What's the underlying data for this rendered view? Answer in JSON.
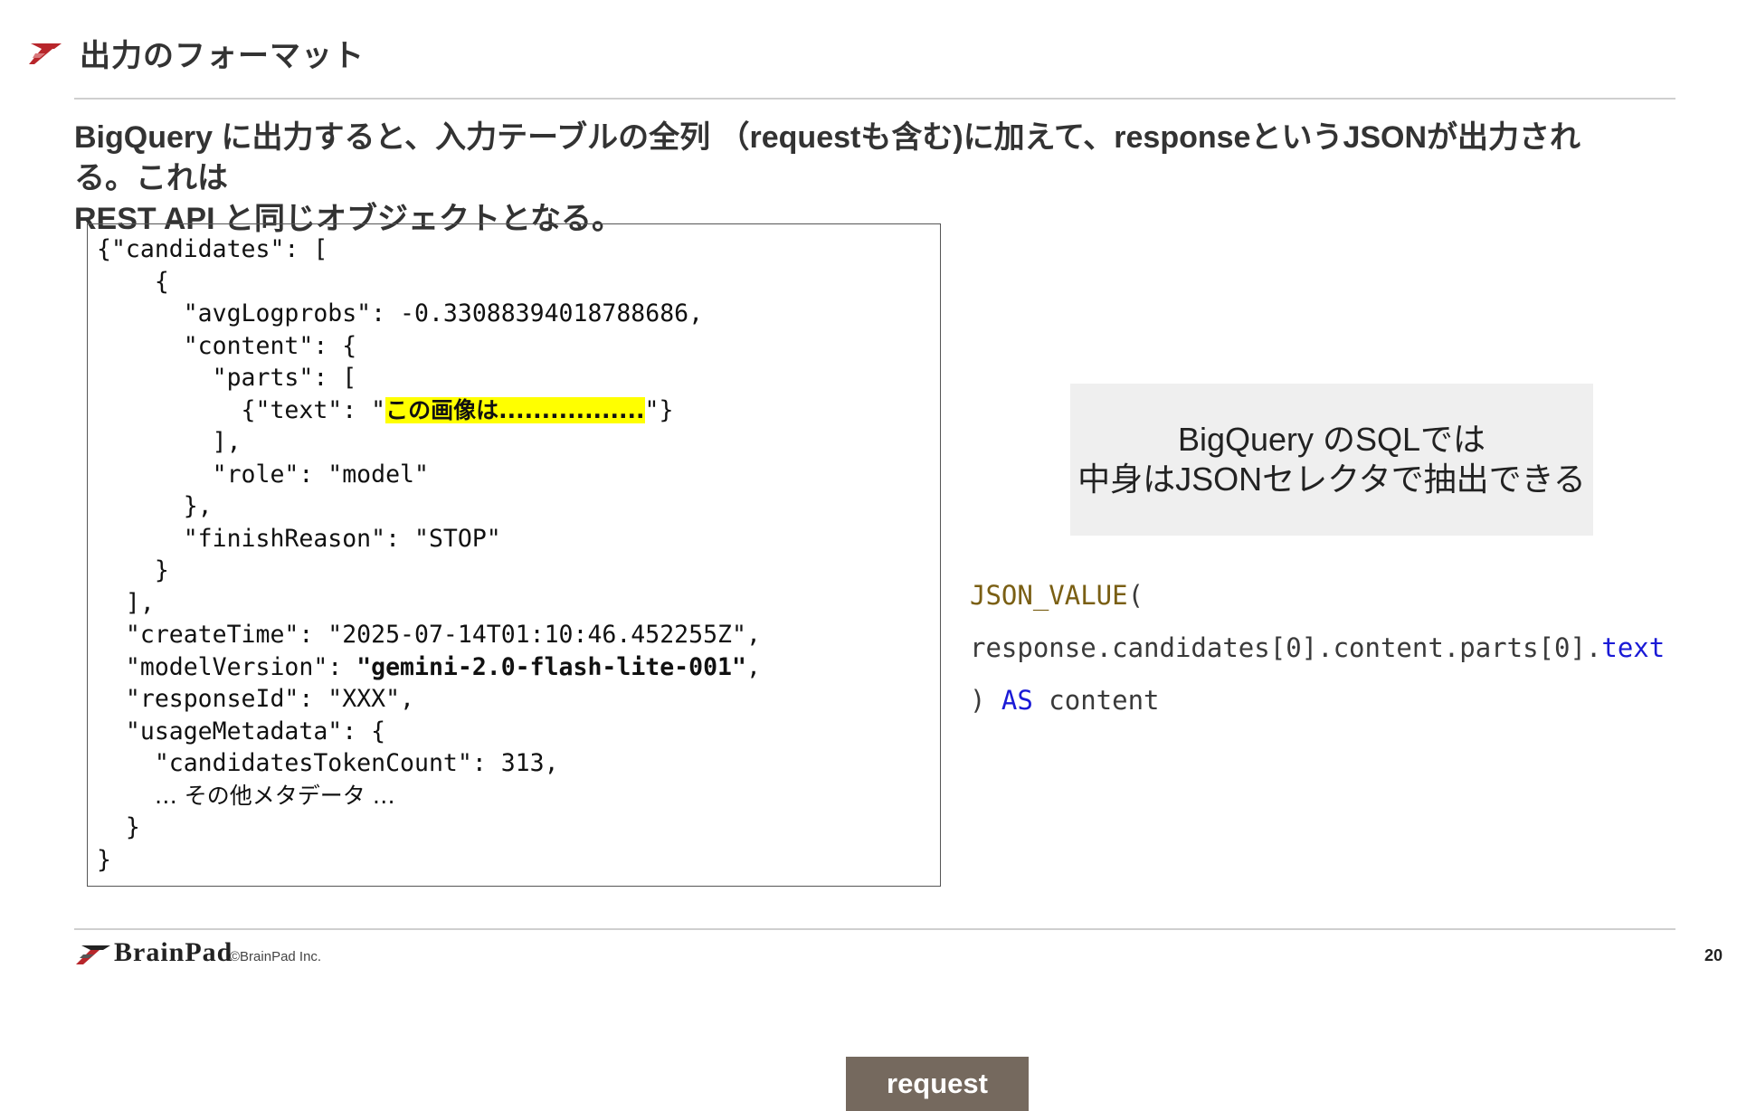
{
  "header": {
    "title": "出力のフォーマット"
  },
  "lead": {
    "line1": "BigQuery に出力すると、入力テーブルの全列 （requestも含む)に加えて、responseというJSONが出力される。これは",
    "line2": "REST API と同じオブジェクトとなる。"
  },
  "code": {
    "l01": "{\"candidates\": [",
    "l02": "    {",
    "l03": "      \"avgLogprobs\": -0.33088394018788686,",
    "l04": "      \"content\": {",
    "l05": "        \"parts\": [",
    "l06_pre": "          {\"text\": \"",
    "l06_hl": "この画像は.................",
    "l06_post": "\"}",
    "l07": "        ],",
    "l08": "        \"role\": \"model\"",
    "l09": "      },",
    "l10": "      \"finishReason\": \"STOP\"",
    "l11": "    }",
    "l12": "  ],",
    "l13": "  \"createTime\": \"2025-07-14T01:10:46.452255Z\",",
    "l14_pre": "  \"modelVersion\": ",
    "l14_bold": "\"gemini-2.0-flash-lite-001\"",
    "l14_post": ",",
    "l15": "  \"responseId\": \"XXX\",",
    "l16": "  \"usageMetadata\": {",
    "l17": "    \"candidatesTokenCount\": 313,",
    "l18_pre": "    ",
    "l18_jp": "… その他メタデータ …",
    "l19": "  }",
    "l20": "}"
  },
  "request_tag": "request",
  "callout": {
    "line1": "BigQuery のSQLでは",
    "line2": "中身はJSONセレクタで抽出できる"
  },
  "sql": {
    "fn": "JSON_VALUE",
    "paren_open": "(",
    "path_main": "response.candidates[0].content.parts[0].",
    "path_text": "text",
    "close_paren": ") ",
    "as_kw": "AS",
    "alias": " content"
  },
  "footer": {
    "brand": "BrainPad",
    "copyright": "©BrainPad Inc.",
    "page_number": "20"
  },
  "colors": {
    "brand_red": "#b8262b",
    "highlight": "#ffff00",
    "tag_bg": "#75695e",
    "sql_function": "#7a5f14",
    "sql_keyword": "#1a1ad6"
  }
}
